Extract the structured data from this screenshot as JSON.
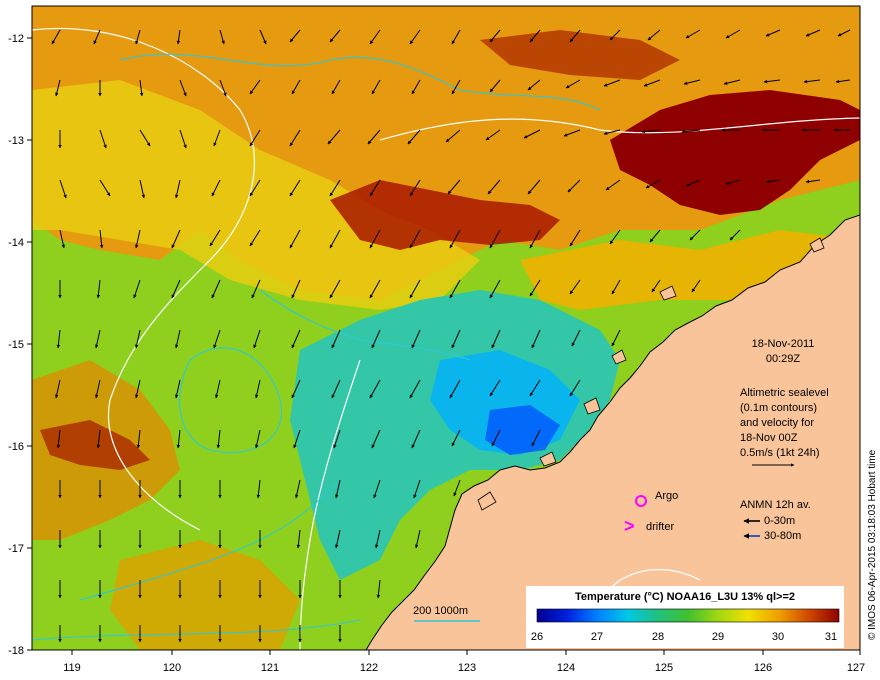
{
  "map": {
    "lon_ticks": [
      "119",
      "120",
      "121",
      "122",
      "123",
      "124",
      "125",
      "126",
      "127"
    ],
    "lat_ticks": [
      "-12",
      "-13",
      "-14",
      "-15",
      "-16",
      "-17",
      "-18"
    ],
    "land_color": "#f9c49a",
    "sea_colors": [
      "#00008f",
      "#0040ff",
      "#00b0ff",
      "#33c7a7",
      "#3fbf3f",
      "#8ed01d",
      "#d8d400",
      "#f6c400",
      "#e08a00",
      "#c23a00",
      "#8f0000"
    ]
  },
  "date_block": {
    "date": "18-Nov-2011",
    "time": "00:29Z"
  },
  "altimetry_block": {
    "line1": "Altimetric sealevel",
    "line2": "(0.1m contours)",
    "line3": "and velocity for",
    "line4": "18-Nov 00Z",
    "line5": "0.5m/s (1kt 24h)"
  },
  "legend": {
    "argo_label": "Argo",
    "drifter_label": "drifter",
    "drifter_symbol": ">",
    "anmn_title": "ANMN 12h av.",
    "anmn_item1": "0-30m",
    "anmn_item2": "30-80m",
    "isobath_label": "200  1000m"
  },
  "colorbar": {
    "title": "Temperature (°C) NOAA16_L3U 13% ql>=2",
    "ticks": [
      "26",
      "27",
      "28",
      "29",
      "30",
      "31"
    ]
  },
  "credit": "© IMOS 06-Apr-2015 03:18:03 Hobart time"
}
